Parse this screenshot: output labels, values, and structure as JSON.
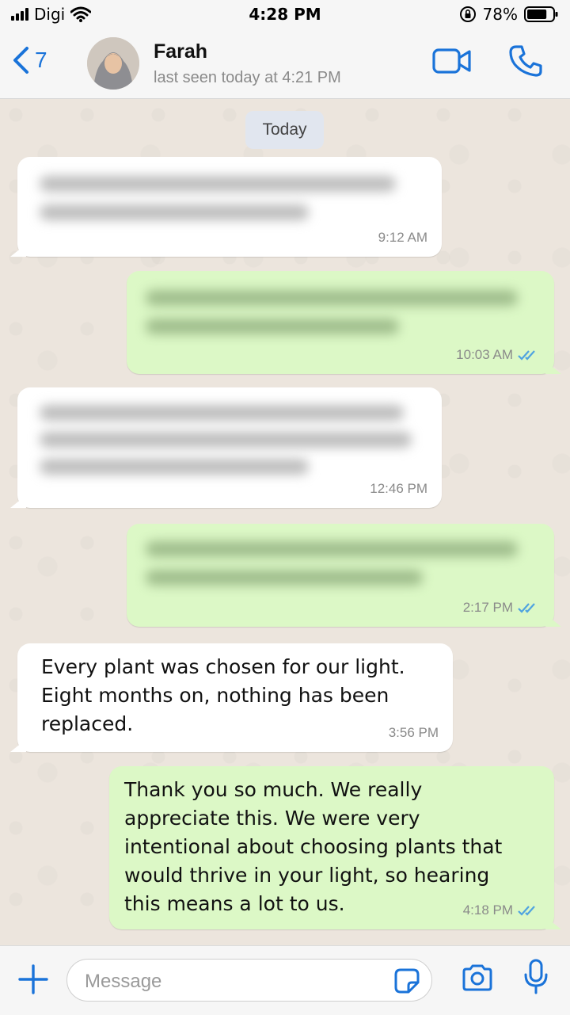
{
  "status_bar": {
    "carrier": "Digi",
    "time": "4:28 PM",
    "battery_percent": "78%",
    "battery_level": 0.78,
    "icons": [
      "signal-icon",
      "wifi-icon",
      "orientation-lock-icon",
      "battery-icon"
    ]
  },
  "header": {
    "back_count": "7",
    "contact_name": "Farah",
    "last_seen": "last seen today at 4:21 PM",
    "icons": [
      "chevron-left-icon",
      "avatar",
      "video-camera-icon",
      "phone-icon"
    ]
  },
  "chat": {
    "date_label": "Today",
    "messages": [
      {
        "direction": "incoming",
        "blurred": true,
        "time": "9:12 AM"
      },
      {
        "direction": "outgoing",
        "blurred": true,
        "time": "10:03 AM",
        "read": true
      },
      {
        "direction": "incoming",
        "blurred": true,
        "time": "12:46 PM"
      },
      {
        "direction": "outgoing",
        "blurred": true,
        "time": "2:17 PM",
        "read": true
      },
      {
        "direction": "incoming",
        "blurred": false,
        "text": "Every plant was chosen for our light.\nEight months on, nothing has been\nreplaced.",
        "time": "3:56 PM"
      },
      {
        "direction": "outgoing",
        "blurred": false,
        "text": "Thank you so much. We really\nappreciate this. We were very\nintentional about choosing plants that\nwould thrive in your light, so hearing\nthis means a lot to us.",
        "time": "4:18 PM",
        "read": true
      }
    ]
  },
  "input_bar": {
    "placeholder": "Message",
    "icons": [
      "plus-icon",
      "sticker-icon",
      "camera-icon",
      "microphone-icon"
    ]
  },
  "colors": {
    "accent": "#1a73d9",
    "outgoing_bubble": "#dcf8c6",
    "incoming_bubble": "#ffffff",
    "read_ticks": "#4fa3e0",
    "chat_background": "#ece5dd"
  }
}
